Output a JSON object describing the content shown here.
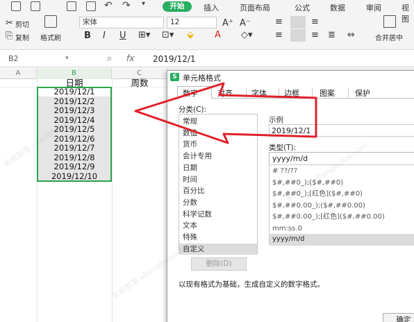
{
  "quick_access": [
    "save-icon",
    "print-icon",
    "preview-icon",
    "undo-icon",
    "redo-icon",
    "dropdown-icon"
  ],
  "menu_tabs": {
    "start": "开始",
    "insert": "插入",
    "page_layout": "页面布局",
    "formula": "公式",
    "data": "数据",
    "review": "审阅",
    "view": "视图"
  },
  "ribbon": {
    "cut": "剪切",
    "copy": "复制",
    "format_painter": "格式刷",
    "font_name": "宋体",
    "font_size": "12",
    "bold": "B",
    "italic": "I",
    "underline": "U",
    "merge_center": "合并居中"
  },
  "formula_bar": {
    "name_box": "B2",
    "fx": "fx",
    "value": "2019/12/1"
  },
  "columns": {
    "a": "A",
    "b": "B",
    "c": "C"
  },
  "sheet": {
    "header_date": "日期",
    "header_week": "周数",
    "dates": [
      "2019/12/1",
      "2019/12/2",
      "2019/12/3",
      "2019/12/4",
      "2019/12/5",
      "2019/12/6",
      "2019/12/7",
      "2019/12/8",
      "2019/12/9",
      "2019/12/10"
    ]
  },
  "dialog": {
    "title": "单元格格式",
    "tabs": [
      "数字",
      "对齐",
      "字体",
      "边框",
      "图案",
      "保护"
    ],
    "category_label": "分类(C):",
    "categories": [
      "常规",
      "数值",
      "货币",
      "会计专用",
      "日期",
      "时间",
      "百分比",
      "分数",
      "科学记数",
      "文本",
      "特殊",
      "自定义"
    ],
    "selected_category": "自定义",
    "sample_label": "示例",
    "sample_value": "2019/12/1",
    "type_label": "类型(T):",
    "type_value": "yyyy/m/d",
    "type_list": [
      "# ??/??",
      "$#,##0_);($#,##0)",
      "$#,##0_);[红色]($#,##0)",
      "$#,##0.00_);($#,##0.00)",
      "$#,##0.00_);[红色]($#,##0.00)",
      "mm:ss.0",
      "yyyy/m/d"
    ],
    "delete_button": "删除(D)",
    "note": "以现有格式为基础，生成自定义的数字格式。",
    "ok_button": "确定"
  },
  "watermark": "系统部落 xitongbuluo.com",
  "colors": {
    "accent_green": "#27ae60",
    "arrow_red": "#e0202a",
    "selection_border": "#2aa34a"
  }
}
